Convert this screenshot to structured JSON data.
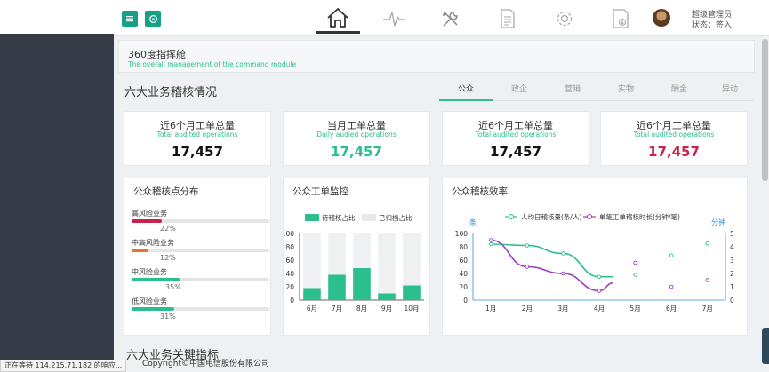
{
  "header": {
    "nav_icons": [
      "home-icon",
      "pulse-icon",
      "tools-icon",
      "document-icon",
      "gear-icon",
      "download-doc-icon"
    ],
    "user": {
      "name": "超级管理员",
      "status": "状态：签入"
    }
  },
  "module": {
    "title": "360度指挥舱",
    "subtitle": "The overall management of the command module"
  },
  "section": {
    "title": "六大业务稽核情况",
    "tabs": [
      "公众",
      "政企",
      "营销",
      "实物",
      "酬金",
      "异动"
    ],
    "active_tab": 0
  },
  "stats": [
    {
      "title": "近6个月工单总量",
      "subtitle": "Total audited operations",
      "value": "17,457",
      "color": "#111111"
    },
    {
      "title": "当月工单总量",
      "subtitle": "Daily audied operations",
      "value": "17,457",
      "color": "#2abf8c"
    },
    {
      "title": "近6个月工单总量",
      "subtitle": "Total audited operations",
      "value": "17,457",
      "color": "#111111"
    },
    {
      "title": "近6个月工单总量",
      "subtitle": "Total audited operations",
      "value": "17,457",
      "color": "#c8234a"
    }
  ],
  "risk_panel": {
    "title": "公众稽核点分布",
    "items": [
      {
        "label": "高风险业务",
        "percent": "22%",
        "fraction": 0.22,
        "color": "#c8234a"
      },
      {
        "label": "中高风险业务",
        "percent": "12%",
        "fraction": 0.12,
        "color": "#e8742b"
      },
      {
        "label": "中风险业务",
        "percent": "35%",
        "fraction": 0.35,
        "color": "#2abf8c"
      },
      {
        "label": "低风险业务",
        "percent": "31%",
        "fraction": 0.31,
        "color": "#2abf8c"
      }
    ]
  },
  "monitor_panel": {
    "title": "公众工单监控"
  },
  "efficiency_panel": {
    "title": "公众稽核效率"
  },
  "chart_data": [
    {
      "type": "bar",
      "categories": [
        "6月",
        "7月",
        "8月",
        "9月",
        "10月"
      ],
      "series": [
        {
          "name": "待稽核占比",
          "values": [
            18,
            38,
            48,
            10,
            22
          ],
          "color": "#2abf8c"
        },
        {
          "name": "已归档占比",
          "values": [
            100,
            100,
            100,
            100,
            100
          ],
          "color": "#eef0f2"
        }
      ],
      "yticks": [
        "0",
        "20",
        "40",
        "60",
        "80",
        "100"
      ],
      "ylim": [
        0,
        100
      ]
    },
    {
      "type": "line",
      "categories": [
        "1月",
        "2月",
        "3月",
        "4月",
        "5月",
        "6月",
        "7月"
      ],
      "left_unit": "条",
      "right_unit": "分钟",
      "yticks_left": [
        "0",
        "20",
        "40",
        "60",
        "80",
        "100"
      ],
      "yticks_right": [
        "0",
        "1",
        "2",
        "3",
        "4",
        "5"
      ],
      "ylim_left": [
        0,
        100
      ],
      "ylim_right": [
        0,
        5
      ],
      "series": [
        {
          "name": "人均日稽核量(条/人)",
          "color": "#2abf8c",
          "axis": "left",
          "values": [
            84,
            82,
            70,
            35,
            38,
            67,
            85
          ]
        },
        {
          "name": "单笔工单稽核时长(分钟/笔)",
          "color": "#9b3fbe",
          "axis": "right",
          "values": [
            4.5,
            2.5,
            2,
            0.7,
            2.8,
            1,
            1.5
          ]
        }
      ]
    }
  ],
  "footer": {
    "section_title": "六大业务关键指标",
    "copyright": "Copyright©中国电信股份有限公司",
    "status": "正在等待 114.215.71.182 的响应..."
  }
}
